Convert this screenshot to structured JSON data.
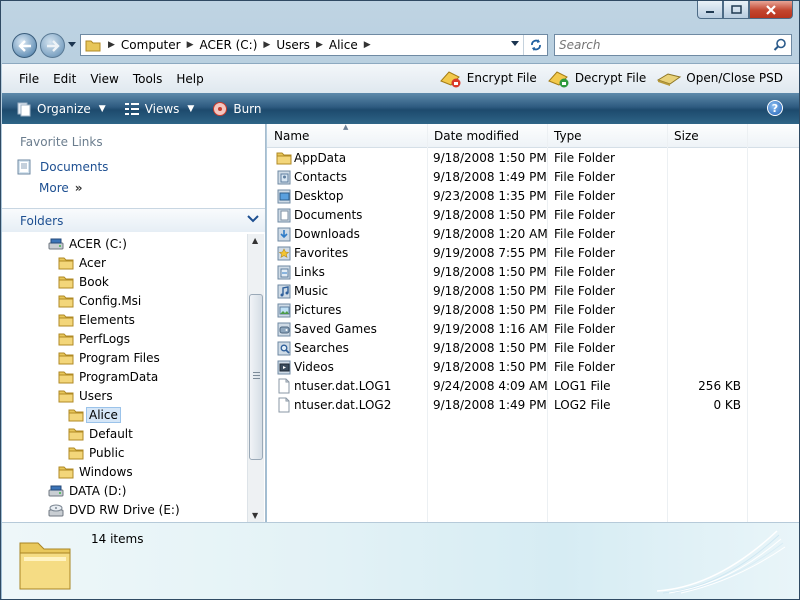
{
  "address": {
    "crumbs": [
      "Computer",
      "ACER (C:)",
      "Users",
      "Alice"
    ]
  },
  "search": {
    "placeholder": "Search"
  },
  "menu": [
    "File",
    "Edit",
    "View",
    "Tools",
    "Help"
  ],
  "extensions": {
    "encrypt": "Encrypt File",
    "decrypt": "Decrypt File",
    "openclose": "Open/Close PSD"
  },
  "commands": {
    "organize": "Organize",
    "views": "Views",
    "burn": "Burn"
  },
  "favorites": {
    "title": "Favorite Links",
    "documents": "Documents",
    "more": "More"
  },
  "folders_label": "Folders",
  "tree": [
    {
      "label": "ACER (C:)",
      "icon": "drive-icon"
    },
    {
      "label": "Acer",
      "icon": "folder-icon"
    },
    {
      "label": "Book",
      "icon": "folder-icon"
    },
    {
      "label": "Config.Msi",
      "icon": "folder-icon"
    },
    {
      "label": "Elements",
      "icon": "folder-icon"
    },
    {
      "label": "PerfLogs",
      "icon": "folder-icon"
    },
    {
      "label": "Program Files",
      "icon": "folder-icon"
    },
    {
      "label": "ProgramData",
      "icon": "folder-icon"
    },
    {
      "label": "Users",
      "icon": "folder-icon"
    },
    {
      "label": "Alice",
      "icon": "folder-icon",
      "selected": true
    },
    {
      "label": "Default",
      "icon": "folder-icon"
    },
    {
      "label": "Public",
      "icon": "folder-icon"
    },
    {
      "label": "Windows",
      "icon": "folder-icon"
    },
    {
      "label": "DATA (D:)",
      "icon": "drive-icon"
    },
    {
      "label": "DVD RW Drive (E:)",
      "icon": "dvd-icon"
    }
  ],
  "columns": [
    "Name",
    "Date modified",
    "Type",
    "Size"
  ],
  "files": [
    {
      "name": "AppData",
      "date": "9/18/2008 1:50 PM",
      "type": "File Folder",
      "size": "",
      "icon": "folder-icon"
    },
    {
      "name": "Contacts",
      "date": "9/18/2008 1:49 PM",
      "type": "File Folder",
      "size": "",
      "icon": "contacts-folder-icon"
    },
    {
      "name": "Desktop",
      "date": "9/23/2008 1:35 PM",
      "type": "File Folder",
      "size": "",
      "icon": "desktop-folder-icon"
    },
    {
      "name": "Documents",
      "date": "9/18/2008 1:50 PM",
      "type": "File Folder",
      "size": "",
      "icon": "documents-folder-icon"
    },
    {
      "name": "Downloads",
      "date": "9/18/2008 1:20 AM",
      "type": "File Folder",
      "size": "",
      "icon": "downloads-folder-icon"
    },
    {
      "name": "Favorites",
      "date": "9/19/2008 7:55 PM",
      "type": "File Folder",
      "size": "",
      "icon": "favorites-folder-icon"
    },
    {
      "name": "Links",
      "date": "9/18/2008 1:50 PM",
      "type": "File Folder",
      "size": "",
      "icon": "links-folder-icon"
    },
    {
      "name": "Music",
      "date": "9/18/2008 1:50 PM",
      "type": "File Folder",
      "size": "",
      "icon": "music-folder-icon"
    },
    {
      "name": "Pictures",
      "date": "9/18/2008 1:50 PM",
      "type": "File Folder",
      "size": "",
      "icon": "pictures-folder-icon"
    },
    {
      "name": "Saved Games",
      "date": "9/19/2008 1:16 AM",
      "type": "File Folder",
      "size": "",
      "icon": "saved-games-folder-icon"
    },
    {
      "name": "Searches",
      "date": "9/18/2008 1:50 PM",
      "type": "File Folder",
      "size": "",
      "icon": "searches-folder-icon"
    },
    {
      "name": "Videos",
      "date": "9/18/2008 1:50 PM",
      "type": "File Folder",
      "size": "",
      "icon": "videos-folder-icon"
    },
    {
      "name": "ntuser.dat.LOG1",
      "date": "9/24/2008 4:09 AM",
      "type": "LOG1 File",
      "size": "256 KB",
      "icon": "file-icon"
    },
    {
      "name": "ntuser.dat.LOG2",
      "date": "9/18/2008 1:49 PM",
      "type": "LOG2 File",
      "size": "0 KB",
      "icon": "file-icon"
    }
  ],
  "status": {
    "count": "14 items"
  }
}
